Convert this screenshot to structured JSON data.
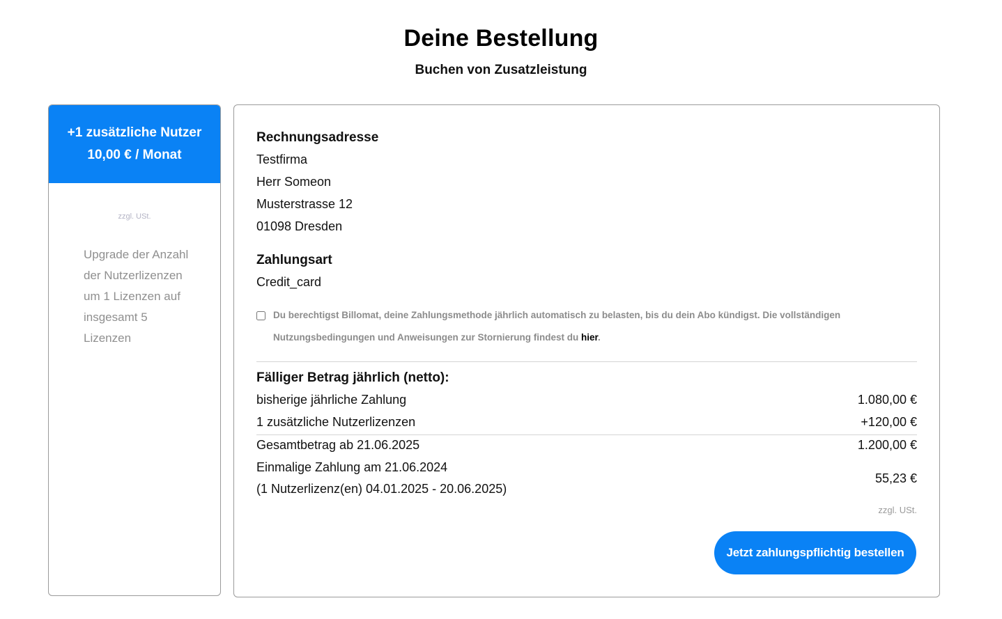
{
  "header": {
    "title": "Deine Bestellung",
    "subtitle": "Buchen von Zusatzleistung"
  },
  "product": {
    "title": "+1 zusätzliche Nutzer",
    "price": "10,00 € / Monat",
    "vat_note": "zzgl. USt.",
    "description": "Upgrade der Anzahl der Nutzerlizenzen um 1 Lizenzen auf insgesamt 5 Lizenzen"
  },
  "billing": {
    "heading": "Rechnungsadresse",
    "company": "Testfirma",
    "name": "Herr Someon",
    "street": "Musterstrasse 12",
    "city": "01098 Dresden"
  },
  "payment": {
    "heading": "Zahlungsart",
    "method": "Credit_card"
  },
  "consent": {
    "checked": false,
    "text_before": "Du berechtigst Billomat, deine Zahlungsmethode jährlich automatisch zu belasten, bis du dein Abo kündigst. Die vollständigen Nutzungsbedingungen und Anweisungen zur Stornierung findest du ",
    "link_label": "hier",
    "text_after": "."
  },
  "summary": {
    "heading": "Fälliger Betrag jährlich (netto):",
    "previous_label": "bisherige jährliche Zahlung",
    "previous_amount": "1.080,00 €",
    "additional_label": "1 zusätzliche Nutzerlizenzen",
    "additional_amount": "+120,00 €",
    "total_label": "Gesamtbetrag ab 21.06.2025",
    "total_amount": "1.200,00 €",
    "onetime_label": "Einmalige Zahlung am 21.06.2024",
    "onetime_detail": "(1 Nutzerlizenz(en) 04.01.2025 - 20.06.2025)",
    "onetime_amount": "55,23 €",
    "vat_note": "zzgl. USt."
  },
  "actions": {
    "order_button": "Jetzt zahlungspflichtig bestellen"
  },
  "colors": {
    "accent": "#0a82f5",
    "muted_text": "#8f8f8f",
    "border": "#9a9a9a"
  }
}
